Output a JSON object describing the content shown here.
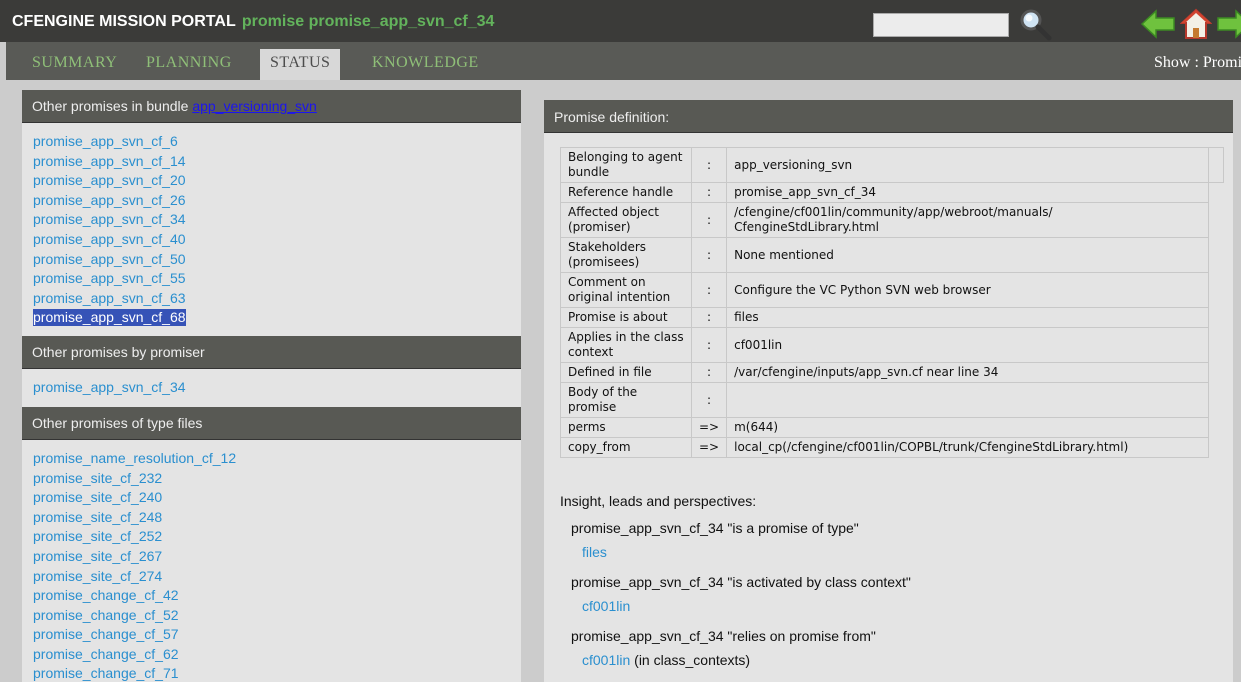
{
  "header": {
    "brand": "CFENGINE MISSION PORTAL",
    "subtitle": "promise promise_app_svn_cf_34",
    "search_value": ""
  },
  "nav": {
    "tabs": [
      "SUMMARY",
      "PLANNING",
      "STATUS",
      "KNOWLEDGE"
    ],
    "active": "STATUS",
    "show_label": "Show : Promi"
  },
  "bundle_panel": {
    "title_prefix": "Other promises in bundle ",
    "bundle_link": "app_versioning_svn",
    "items": [
      "promise_app_svn_cf_6",
      "promise_app_svn_cf_14",
      "promise_app_svn_cf_20",
      "promise_app_svn_cf_26",
      "promise_app_svn_cf_34",
      "promise_app_svn_cf_40",
      "promise_app_svn_cf_50",
      "promise_app_svn_cf_55",
      "promise_app_svn_cf_63",
      "promise_app_svn_cf_68"
    ],
    "selected": "promise_app_svn_cf_68"
  },
  "promiser_panel": {
    "title": "Other promises by promiser",
    "items": [
      "promise_app_svn_cf_34"
    ]
  },
  "type_panel": {
    "title": "Other promises of type files",
    "items": [
      "promise_name_resolution_cf_12",
      "promise_site_cf_232",
      "promise_site_cf_240",
      "promise_site_cf_248",
      "promise_site_cf_252",
      "promise_site_cf_267",
      "promise_site_cf_274",
      "promise_change_cf_42",
      "promise_change_cf_52",
      "promise_change_cf_57",
      "promise_change_cf_62",
      "promise_change_cf_71"
    ]
  },
  "definition": {
    "title": "Promise definition:",
    "rows": [
      {
        "key": "Belonging to agent bundle",
        "sep": ":",
        "value": "app_versioning_svn",
        "link": true
      },
      {
        "key": "Reference handle",
        "sep": ":",
        "value": "promise_app_svn_cf_34",
        "link": true
      },
      {
        "key": "Affected object (promiser)",
        "sep": ":",
        "value": "/cfengine/cf001lin/community/app/webroot/manuals/ CfengineStdLibrary.html",
        "link": true
      },
      {
        "key": "Stakeholders (promisees)",
        "sep": ":",
        "value": "None mentioned",
        "link": false
      },
      {
        "key": "Comment on original intention",
        "sep": ":",
        "value": "Configure the VC Python SVN web browser",
        "link": false
      },
      {
        "key": "Promise is about",
        "sep": ":",
        "value": "files",
        "link": true
      },
      {
        "key": "Applies in the class context",
        "sep": ":",
        "value": "cf001lin",
        "link": true
      },
      {
        "key": "Defined in file",
        "sep": ":",
        "value": "/var/cfengine/inputs/app_svn.cf near line 34",
        "link": false
      },
      {
        "key": "Body of the promise",
        "sep": ":",
        "value": "",
        "link": false
      },
      {
        "key": "perms",
        "sep": "=>",
        "value": "m(644)",
        "link": true,
        "key_link": true
      },
      {
        "key": "copy_from",
        "sep": "=>",
        "value": "local_cp(/cfengine/cf001lin/COPBL/trunk/CfengineStdLibrary.html)",
        "link": true,
        "key_link": true
      }
    ]
  },
  "insight": {
    "heading": "Insight, leads and perspectives:",
    "entries": [
      {
        "statement": "promise_app_svn_cf_34 \"is a promise of type\"",
        "target": "files",
        "suffix": ""
      },
      {
        "statement": "promise_app_svn_cf_34 \"is activated by class context\"",
        "target": "cf001lin",
        "suffix": ""
      },
      {
        "statement": "promise_app_svn_cf_34 \"relies on promise from\"",
        "target": "cf001lin",
        "suffix": " (in class_contexts)"
      }
    ]
  },
  "colors": {
    "topbar": "#3b3b39",
    "nav": "#595a56",
    "panel_header": "#585954",
    "panel_body": "#e4e4e4",
    "link": "#2a8fcf",
    "brand_green": "#63b35c",
    "tab_green": "#8fbf78",
    "selection": "#3653b7"
  },
  "icons": [
    "magnifier-icon",
    "back-arrow-icon",
    "home-icon",
    "forward-arrow-icon"
  ]
}
